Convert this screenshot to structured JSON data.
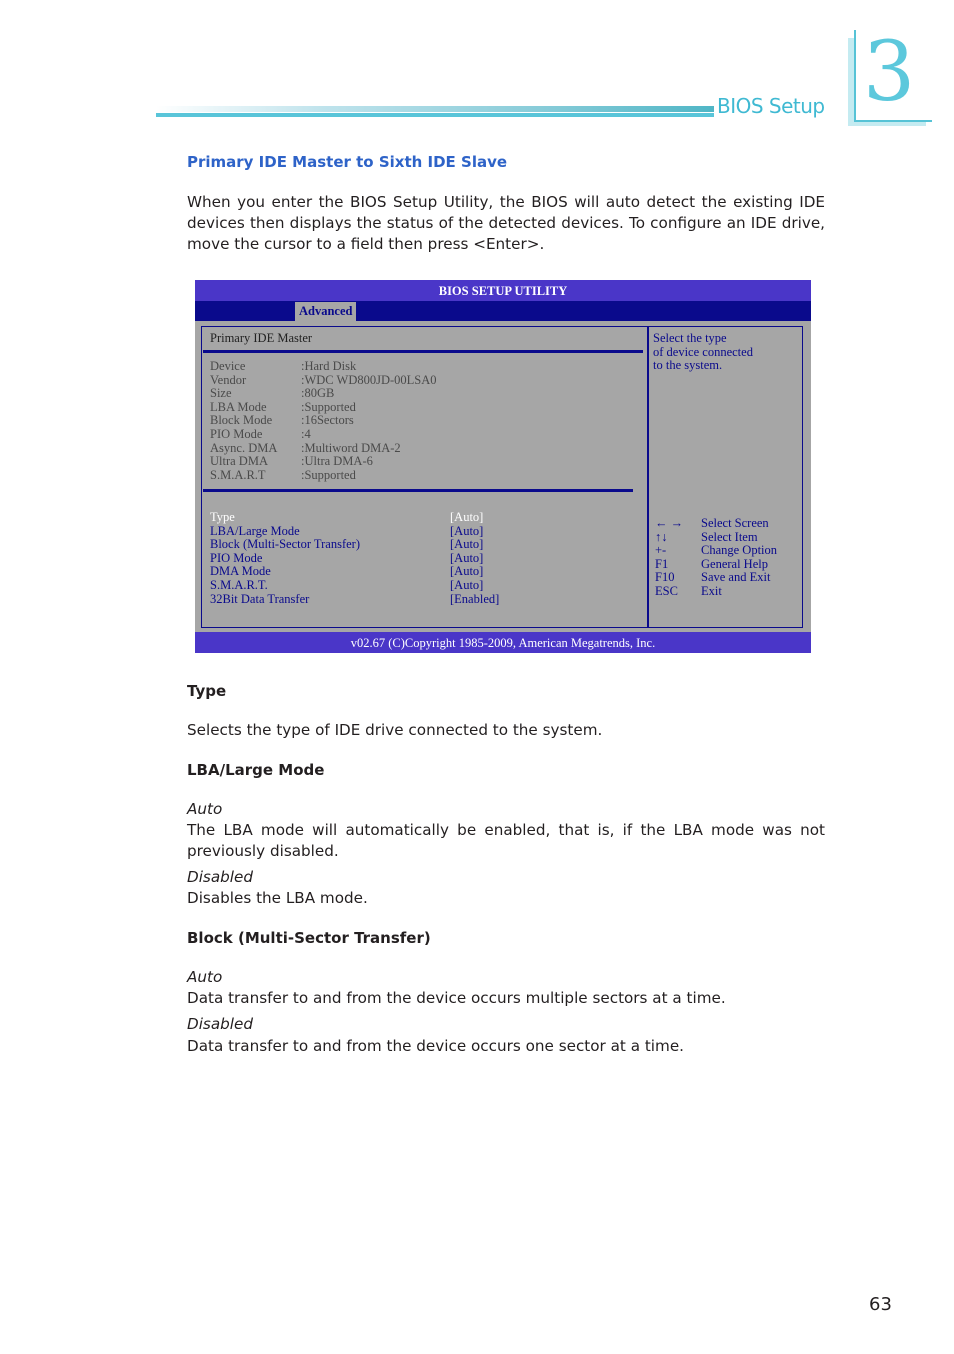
{
  "header": {
    "section_label": "BIOS Setup",
    "chapter_number": "3",
    "accent_color": "#5cc8dc"
  },
  "section": {
    "title": "Primary IDE Master to Sixth IDE Slave",
    "intro": "When you enter the BIOS Setup Utility, the BIOS will auto detect the existing IDE devices then displays the status of the detected devices. To configure an IDE drive, move the cursor to a field then press <Enter>."
  },
  "bios": {
    "title": "BIOS SETUP UTILITY",
    "active_tab": "Advanced",
    "pane_title": "Primary IDE Master",
    "device_info": [
      {
        "label": "Device",
        "value": ":Hard Disk"
      },
      {
        "label": "Vendor",
        "value": ":WDC WD800JD-00LSA0"
      },
      {
        "label": "Size",
        "value": ":80GB"
      },
      {
        "label": "LBA Mode",
        "value": ":Supported"
      },
      {
        "label": "Block Mode",
        "value": ":16Sectors"
      },
      {
        "label": "PIO Mode",
        "value": ":4"
      },
      {
        "label": "Async. DMA",
        "value": ":Multiword DMA-2"
      },
      {
        "label": "Ultra DMA",
        "value": ":Ultra DMA-6"
      },
      {
        "label": "S.M.A.R.T",
        "value": ":Supported"
      }
    ],
    "settings": [
      {
        "label": "Type",
        "value": "[Auto]",
        "selected": true
      },
      {
        "label": "LBA/Large Mode",
        "value": "[Auto]"
      },
      {
        "label": "Block (Multi-Sector Transfer)",
        "value": "[Auto]"
      },
      {
        "label": "PIO Mode",
        "value": "[Auto]"
      },
      {
        "label": "DMA Mode",
        "value": "[Auto]"
      },
      {
        "label": "S.M.A.R.T.",
        "value": "[Auto]"
      },
      {
        "label": "32Bit Data Transfer",
        "value": "[Enabled]"
      }
    ],
    "help_text": [
      "Select the type",
      "of device connected",
      "to the system."
    ],
    "key_legend": [
      {
        "key": "← →",
        "action": "Select Screen"
      },
      {
        "key": "↑↓",
        "action": "Select Item"
      },
      {
        "key": "+-",
        "action": "Change Option"
      },
      {
        "key": "F1",
        "action": "General Help"
      },
      {
        "key": "F10",
        "action": "Save and Exit"
      },
      {
        "key": "ESC",
        "action": "Exit"
      }
    ],
    "footer": "v02.67 (C)Copyright 1985-2009, American Megatrends, Inc.",
    "colors": {
      "title_bar": "#4a36c8",
      "menu_bar": "#0a0a8c",
      "panel_bg": "#a6a6a6",
      "text_blue": "#0a0a8c",
      "selected_text": "#ffffff"
    }
  },
  "descriptions": {
    "type": {
      "heading": "Type",
      "text": "Selects the type of IDE drive connected to the system."
    },
    "lba": {
      "heading": "LBA/Large Mode",
      "options": [
        {
          "name": "Auto",
          "text": "The LBA mode will automatically be enabled, that is, if the LBA mode was not previously disabled."
        },
        {
          "name": "Disabled",
          "text": "Disables the LBA mode."
        }
      ]
    },
    "block": {
      "heading": "Block (Multi-Sector Transfer)",
      "options": [
        {
          "name": "Auto",
          "text": "Data transfer to and from the device occurs multiple sectors at a time."
        },
        {
          "name": "Disabled",
          "text": "Data transfer to and from the device occurs one sector at a time."
        }
      ]
    }
  },
  "page_number": "63"
}
